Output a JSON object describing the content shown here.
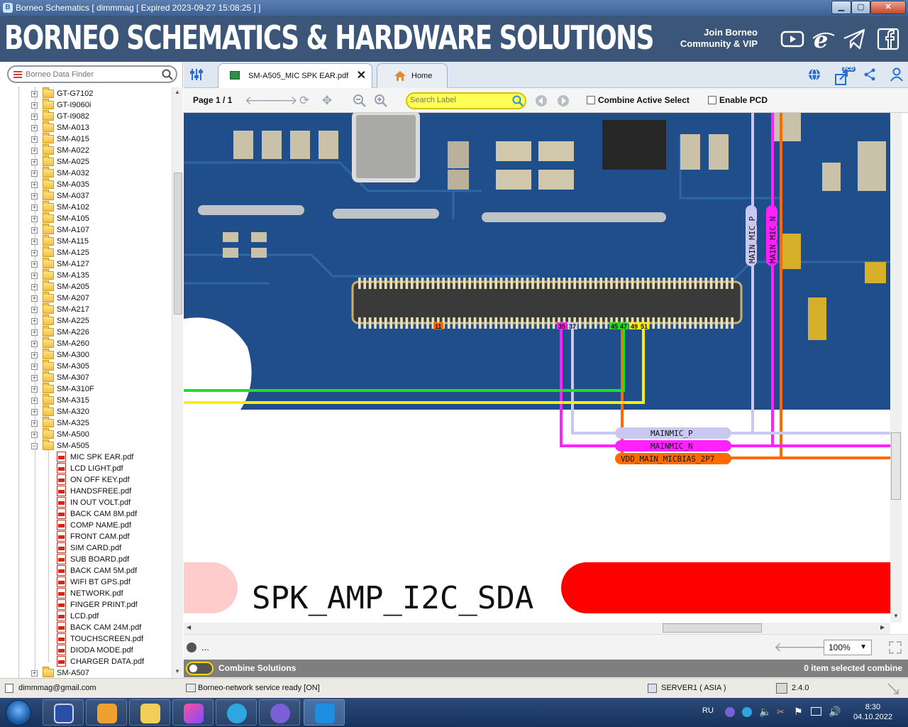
{
  "window": {
    "title": "Borneo Schematics [ dimmmag [ Expired 2023-09-27 15:08:25 ] ]",
    "min": "▁",
    "max": "▢",
    "close": "✕"
  },
  "banner": {
    "title": "BORNEO SCHEMATICS & HARDWARE SOLUTIONS",
    "join_line1": "Join Borneo",
    "join_line2": "Community & VIP"
  },
  "finder": {
    "placeholder": "Borneo Data Finder"
  },
  "tree": {
    "folders": [
      "GT-G7102",
      "GT-I9060i",
      "GT-I9082",
      "SM-A013",
      "SM-A015",
      "SM-A022",
      "SM-A025",
      "SM-A032",
      "SM-A035",
      "SM-A037",
      "SM-A102",
      "SM-A105",
      "SM-A107",
      "SM-A115",
      "SM-A125",
      "SM-A127",
      "SM-A135",
      "SM-A205",
      "SM-A207",
      "SM-A217",
      "SM-A225",
      "SM-A226",
      "SM-A260",
      "SM-A300",
      "SM-A305",
      "SM-A307",
      "SM-A310F",
      "SM-A315",
      "SM-A320",
      "SM-A325",
      "SM-A500",
      "SM-A505"
    ],
    "files": [
      "MIC SPK EAR.pdf",
      "LCD LIGHT.pdf",
      "ON OFF KEY.pdf",
      "HANDSFREE.pdf",
      "IN OUT VOLT.pdf",
      "BACK CAM 8M.pdf",
      "COMP NAME.pdf",
      "FRONT CAM.pdf",
      "SIM CARD.pdf",
      "SUB BOARD.pdf",
      "BACK CAM 5M.pdf",
      "WIFI BT GPS.pdf",
      "NETWORK.pdf",
      "FINGER PRINT.pdf",
      "LCD.pdf",
      "BACK CAM 24M.pdf",
      "TOUCHSCREEN.pdf",
      "DIODA MODE.pdf",
      "CHARGER DATA.pdf"
    ],
    "last_folder": "SM-A507"
  },
  "tabs": {
    "pdf": "SM-A505_MIC SPK EAR.pdf",
    "home": "Home",
    "close": "✕"
  },
  "toolbar": {
    "page": "Page 1 / 1",
    "search_placeholder": "Search Label",
    "combine_active": "Combine Active Select",
    "enable_pcd": "Enable PCD",
    "pcd_badge": "PCD"
  },
  "schematic": {
    "pins": [
      "11",
      "35",
      "37",
      "45",
      "47",
      "49",
      "51"
    ],
    "side_labels": {
      "p": "MAIN_MIC_P",
      "n": "MAIN_MIC_N"
    },
    "net_labels": {
      "p": "MAINMIC_P",
      "n": "MAINMIC_N",
      "bias": "VDD_MAIN_MICBIAS_2P7"
    },
    "big_label": "SPK_AMP_I2C_SDA",
    "colors": {
      "board": "#1f4e8a",
      "green": "#22dd22",
      "yellow": "#ffee00",
      "orange": "#ff6a00",
      "magenta": "#ff22ff",
      "lavender": "#c8c8f2",
      "red": "#ff0000"
    }
  },
  "viewer": {
    "status": "...",
    "zoom": "100%"
  },
  "combine": {
    "label": "Combine Solutions",
    "count": "0 item selected combine"
  },
  "statusbar": {
    "email": "dimmmag@gmail.com",
    "service": "Borneo-network service ready [ON]",
    "server": "SERVER1 ( ASIA )",
    "version": "2.4.0"
  },
  "taskbar": {
    "lang": "RU",
    "time": "8:30",
    "date": "04.10.2022"
  }
}
